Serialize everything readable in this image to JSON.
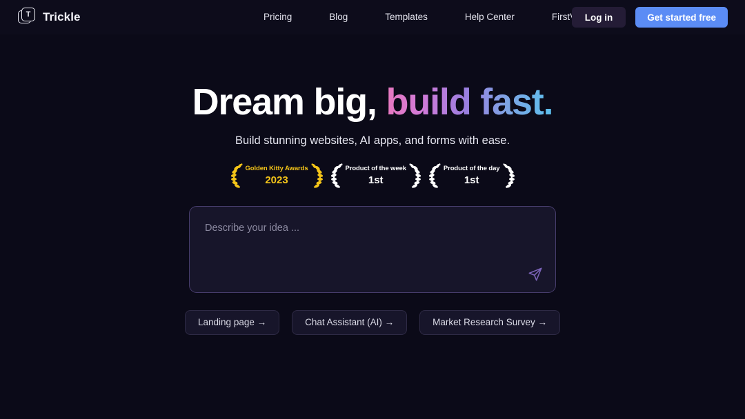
{
  "brand": {
    "name": "Trickle",
    "logo_letter": "T",
    "logo_icon": "trickle-logo-icon"
  },
  "nav": {
    "items": [
      {
        "label": "Pricing"
      },
      {
        "label": "Blog"
      },
      {
        "label": "Templates"
      },
      {
        "label": "Help Center"
      },
      {
        "label": "FirstVersion"
      }
    ]
  },
  "auth": {
    "login_label": "Log in",
    "signup_label": "Get started free",
    "login_bg": "#241c36",
    "signup_bg": "#5b8cf5"
  },
  "hero": {
    "headline_plain": "Dream big, ",
    "headline_gradient": "build fast.",
    "subtitle": "Build stunning websites, AI apps, and forms with ease.",
    "gradient_start": "#e879c0",
    "gradient_mid": "#9b7fe0",
    "gradient_end": "#5cc0ee"
  },
  "awards": [
    {
      "top": "Golden Kitty Awards",
      "bottom": "2023",
      "color": "#f5c518",
      "style": "gold"
    },
    {
      "top": "Product of the week",
      "bottom": "1st",
      "color": "#ffffff",
      "style": "white"
    },
    {
      "top": "Product of the day",
      "bottom": "1st",
      "color": "#ffffff",
      "style": "white"
    }
  ],
  "prompt": {
    "placeholder": "Describe your idea ...",
    "value": "",
    "send_icon": "send-paper-plane-icon",
    "border_color": "#463c6b",
    "send_icon_color": "#7b63b8"
  },
  "suggestions": [
    {
      "label": "Landing page →"
    },
    {
      "label": "Chat Assistant (AI) →"
    },
    {
      "label": "Market Research Survey →"
    }
  ],
  "theme": {
    "page_bg": "#0b0a18",
    "header_bg": "#0d0c1b"
  }
}
